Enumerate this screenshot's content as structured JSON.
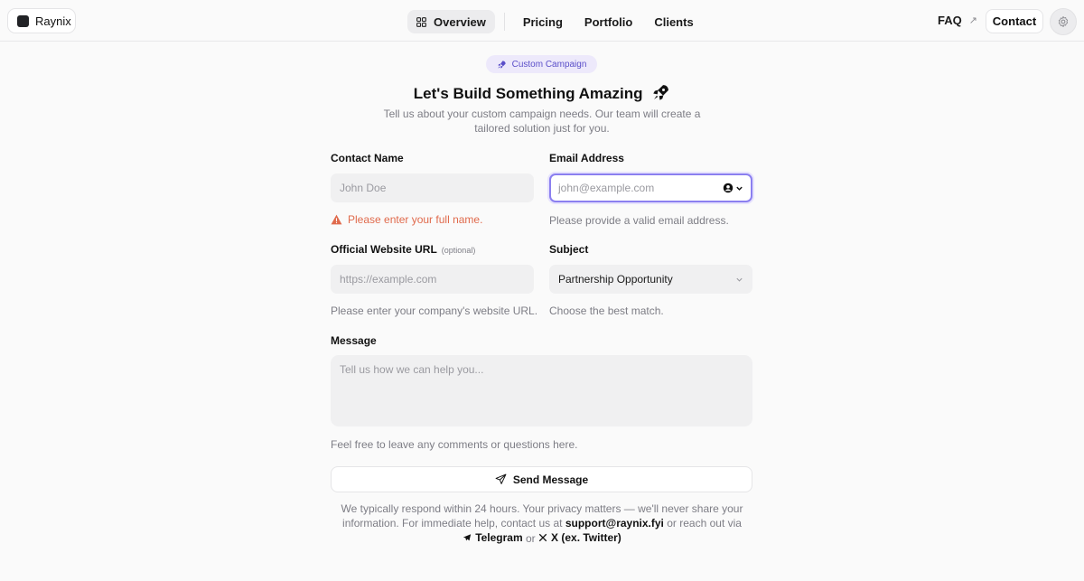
{
  "header": {
    "brand": "Raynix",
    "nav": [
      {
        "label": "Overview",
        "icon": "grid-icon",
        "active": true
      },
      {
        "label": "Pricing"
      },
      {
        "label": "Portfolio"
      },
      {
        "label": "Clients"
      }
    ],
    "faq_label": "FAQ",
    "contact_label": "Contact",
    "theme_icon": "gear-icon"
  },
  "hero": {
    "badge": "Custom Campaign",
    "title": "Let's Build Something Amazing",
    "subtitle": "Tell us about your custom campaign needs. Our team will create a tailored solution just for you."
  },
  "form": {
    "contact_name": {
      "label": "Contact Name",
      "placeholder": "John Doe",
      "error": "Please enter your full name."
    },
    "email": {
      "label": "Email Address",
      "placeholder": "john@example.com",
      "hint": "Please provide a valid email address."
    },
    "website": {
      "label": "Official Website URL",
      "optional": "(optional)",
      "placeholder": "https://example.com",
      "hint": "Please enter your company's website URL."
    },
    "subject": {
      "label": "Subject",
      "value": "Partnership Opportunity",
      "hint": "Choose the best match."
    },
    "message": {
      "label": "Message",
      "placeholder": "Tell us how we can help you...",
      "hint": "Feel free to leave any comments or questions here."
    },
    "submit_label": "Send Message"
  },
  "footer": {
    "text_1": "We typically respond within 24 hours. Your privacy matters — we'll never share your information. For immediate help, contact us at",
    "email": "support@raynix.fyi",
    "text_2": "or reach out via",
    "telegram": "Telegram",
    "or": "or",
    "x": "X (ex. Twitter)"
  },
  "colors": {
    "accent": "#8b7ff0",
    "badge_bg": "#ede9fb",
    "badge_text": "#5b4fc9",
    "error": "#e06a4c"
  }
}
